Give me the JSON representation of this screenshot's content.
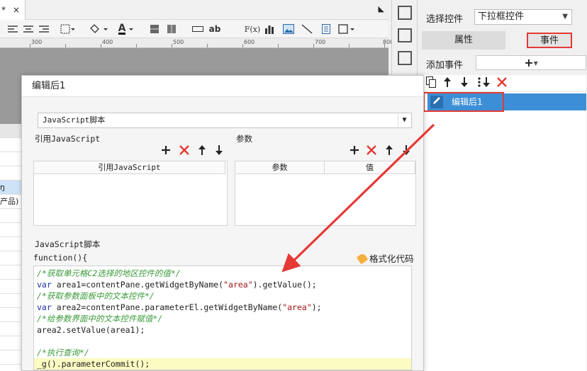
{
  "editor": {
    "tab_label": "*",
    "tab_close": "×",
    "tab_menu": "◣",
    "ruler_marks": [
      "300",
      "400",
      "500",
      "600",
      "700",
      "800"
    ],
    "sheet_rows": [
      "",
      "",
      "",
      "",
      "ŋ",
      "产品)",
      "",
      "",
      "",
      "",
      "",
      "",
      "",
      "",
      "",
      "",
      ""
    ]
  },
  "toolbar": {
    "icons": [
      "align-left-icon",
      "align-center-icon",
      "align-right-icon",
      "border-icon",
      "fill-color-icon",
      "font-color-icon",
      "cell-icon",
      "merge-icon",
      "textbox-icon",
      "text-icon",
      "formula-icon",
      "chart-icon",
      "image-icon",
      "slash-icon",
      "richtext-icon",
      "widget-icon"
    ],
    "text_ab": "ab",
    "text_fx": "F(x)",
    "text_a": "A"
  },
  "right_panel": {
    "select_label": "选择控件",
    "select_value": "下拉框控件",
    "tab_props": "属性",
    "tab_events": "事件",
    "add_event_label": "添加事件",
    "add_event_button": "+",
    "events": [
      {
        "name": "编辑后1"
      }
    ]
  },
  "dialog": {
    "title": "编辑后1",
    "type_value": "JavaScript脚本",
    "ref_js_label": "引用JavaScript",
    "params_label": "参数",
    "ref_js_col": "引用JavaScript",
    "params_col_param": "参数",
    "params_col_value": "值",
    "script_label": "JavaScript脚本",
    "function_header": "function(){",
    "format_button": "格式化代码"
  },
  "code": {
    "lines": [
      {
        "parts": [
          {
            "t": "/*获取单元格C2选择的地区控件的值*/",
            "c": "cm"
          }
        ]
      },
      {
        "parts": [
          {
            "t": "var",
            "c": "kw"
          },
          {
            "t": " area1=contentPane.getWidgetByName(",
            "c": ""
          },
          {
            "t": "\"area\"",
            "c": "st"
          },
          {
            "t": ").getValue();",
            "c": ""
          }
        ]
      },
      {
        "parts": [
          {
            "t": "/*获取参数面板中的文本控件*/",
            "c": "cm"
          }
        ]
      },
      {
        "parts": [
          {
            "t": "var",
            "c": "kw"
          },
          {
            "t": " area2=contentPane.parameterEl.getWidgetByName(",
            "c": ""
          },
          {
            "t": "\"area\"",
            "c": "st"
          },
          {
            "t": ");",
            "c": ""
          }
        ]
      },
      {
        "parts": [
          {
            "t": "/*给参数界面中的文本控件赋值*/",
            "c": "cm"
          }
        ]
      },
      {
        "parts": [
          {
            "t": "area2.setValue(area1);",
            "c": ""
          }
        ]
      },
      {
        "parts": [
          {
            "t": "",
            "c": ""
          }
        ]
      },
      {
        "parts": [
          {
            "t": "/*执行查询*/",
            "c": "cm"
          }
        ]
      },
      {
        "parts": [
          {
            "t": "_g().parameterCommit();",
            "c": ""
          }
        ],
        "highlight": true
      }
    ]
  },
  "colors": {
    "accent_red": "#e53935",
    "selection_blue": "#3c8fd7",
    "comment_green": "#3a9a3a",
    "keyword_blue": "#1c2ea8",
    "string_red": "#a31515"
  }
}
